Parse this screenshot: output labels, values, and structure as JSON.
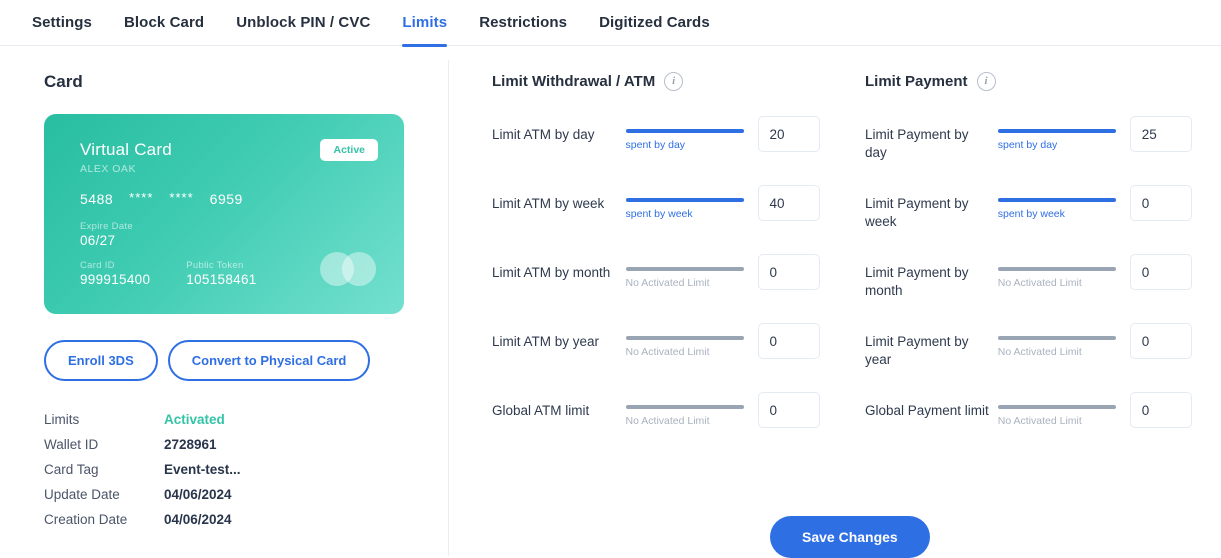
{
  "tabs": [
    {
      "label": "Settings",
      "active": false
    },
    {
      "label": "Block Card",
      "active": false
    },
    {
      "label": "Unblock PIN / CVC",
      "active": false
    },
    {
      "label": "Limits",
      "active": true
    },
    {
      "label": "Restrictions",
      "active": false
    },
    {
      "label": "Digitized Cards",
      "active": false
    }
  ],
  "left": {
    "section_title": "Card",
    "card": {
      "title": "Virtual Card",
      "holder": "ALEX OAK",
      "number_first": "5488",
      "number_mask_1": "****",
      "number_mask_2": "****",
      "number_last": "6959",
      "expire_label": "Expire Date",
      "expire_value": "06/27",
      "card_id_label": "Card ID",
      "card_id_value": "999915400",
      "public_token_label": "Public Token",
      "public_token_value": "105158461",
      "status_badge": "Active"
    },
    "actions": {
      "enroll_3ds": "Enroll 3DS",
      "convert_physical": "Convert to Physical Card"
    },
    "info": [
      {
        "key": "Limits",
        "value": "Activated",
        "accent": true
      },
      {
        "key": "Wallet ID",
        "value": "2728961",
        "accent": false
      },
      {
        "key": "Card Tag",
        "value": "Event-test...",
        "accent": false
      },
      {
        "key": "Update Date",
        "value": "04/06/2024",
        "accent": false
      },
      {
        "key": "Creation Date",
        "value": "04/06/2024",
        "accent": false
      }
    ]
  },
  "withdrawal": {
    "title": "Limit Withdrawal / ATM",
    "rows": [
      {
        "label": "Limit ATM by day",
        "caption": "spent by day",
        "active": true,
        "value": "20"
      },
      {
        "label": "Limit ATM by week",
        "caption": "spent by week",
        "active": true,
        "value": "40"
      },
      {
        "label": "Limit ATM by month",
        "caption": "No Activated Limit",
        "active": false,
        "value": "0"
      },
      {
        "label": "Limit ATM by year",
        "caption": "No Activated Limit",
        "active": false,
        "value": "0"
      },
      {
        "label": "Global ATM limit",
        "caption": "No Activated Limit",
        "active": false,
        "value": "0"
      }
    ]
  },
  "payment": {
    "title": "Limit Payment",
    "rows": [
      {
        "label": "Limit Payment by day",
        "caption": "spent by day",
        "active": true,
        "value": "25"
      },
      {
        "label": "Limit Payment by week",
        "caption": "spent by week",
        "active": true,
        "value": "0"
      },
      {
        "label": "Limit Payment by month",
        "caption": "No Activated Limit",
        "active": false,
        "value": "0"
      },
      {
        "label": "Limit Payment by year",
        "caption": "No Activated Limit",
        "active": false,
        "value": "0"
      },
      {
        "label": "Global Payment limit",
        "caption": "No Activated Limit",
        "active": false,
        "value": "0"
      }
    ]
  },
  "save_button": "Save Changes",
  "colors": {
    "accent_blue": "#2f6fe4",
    "teal": "#33c3a6",
    "inactive_gray": "#9aa5b4"
  }
}
